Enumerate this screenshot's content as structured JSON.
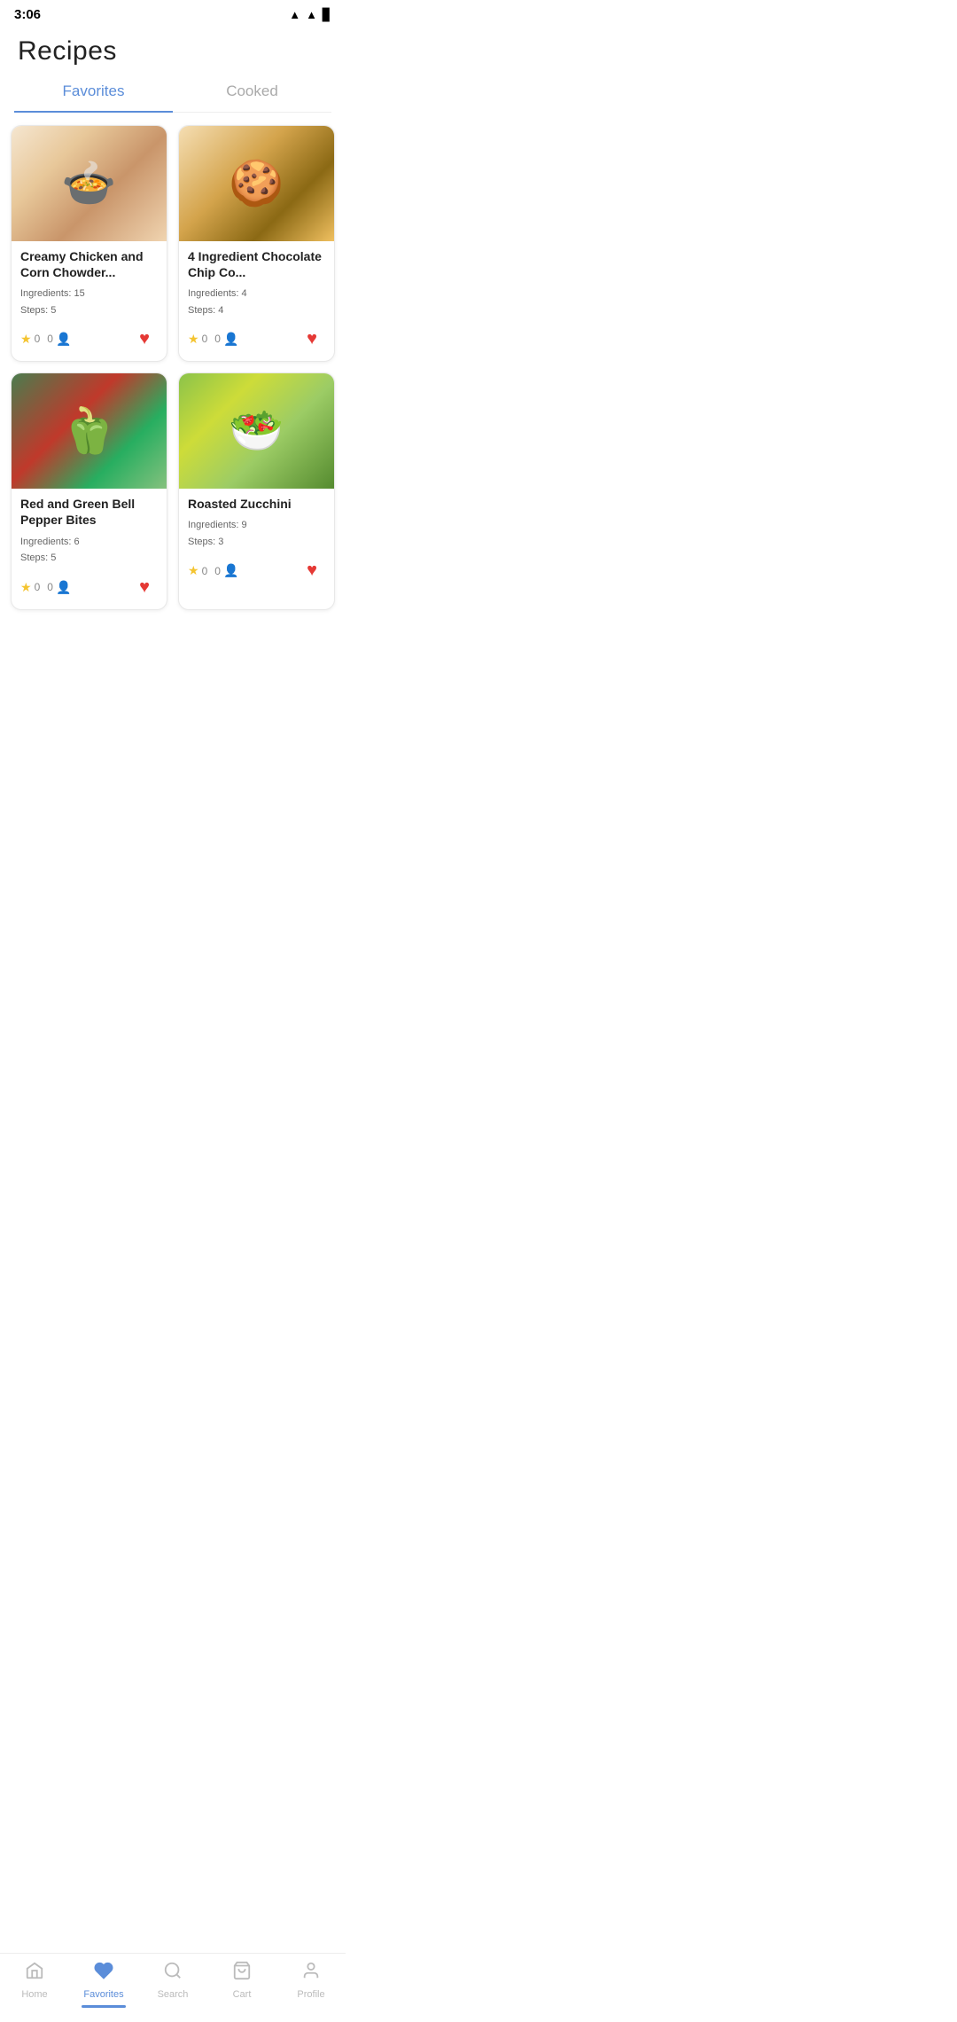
{
  "statusBar": {
    "time": "3:06"
  },
  "page": {
    "title": "Recipes"
  },
  "tabs": [
    {
      "id": "favorites",
      "label": "Favorites",
      "active": true
    },
    {
      "id": "cooked",
      "label": "Cooked",
      "active": false
    }
  ],
  "recipes": [
    {
      "id": "r1",
      "name": "Creamy Chicken and Corn Chowder...",
      "ingredients": "Ingredients: 15",
      "steps": "Steps: 5",
      "rating": "0",
      "people": "0",
      "imgClass": "img-chowder",
      "favorited": true
    },
    {
      "id": "r2",
      "name": "4 Ingredient Chocolate Chip Co...",
      "ingredients": "Ingredients: 4",
      "steps": "Steps: 4",
      "rating": "0",
      "people": "0",
      "imgClass": "img-cookies",
      "favorited": true
    },
    {
      "id": "r3",
      "name": "Red and Green Bell Pepper Bites",
      "ingredients": "Ingredients: 6",
      "steps": "Steps: 5",
      "rating": "0",
      "people": "0",
      "imgClass": "img-peppers",
      "favorited": true
    },
    {
      "id": "r4",
      "name": "Roasted Zucchini",
      "ingredients": "Ingredients: 9",
      "steps": "Steps: 3",
      "rating": "0",
      "people": "0",
      "imgClass": "img-zucchini",
      "favorited": true
    }
  ],
  "bottomNav": {
    "items": [
      {
        "id": "home",
        "label": "Home",
        "icon": "🏠",
        "active": false
      },
      {
        "id": "favorites",
        "label": "Favorites",
        "icon": "♡",
        "active": true
      },
      {
        "id": "search",
        "label": "Search",
        "icon": "🔍",
        "active": false
      },
      {
        "id": "cart",
        "label": "Cart",
        "icon": "🛒",
        "active": false
      },
      {
        "id": "profile",
        "label": "Profile",
        "icon": "👤",
        "active": false
      }
    ]
  }
}
